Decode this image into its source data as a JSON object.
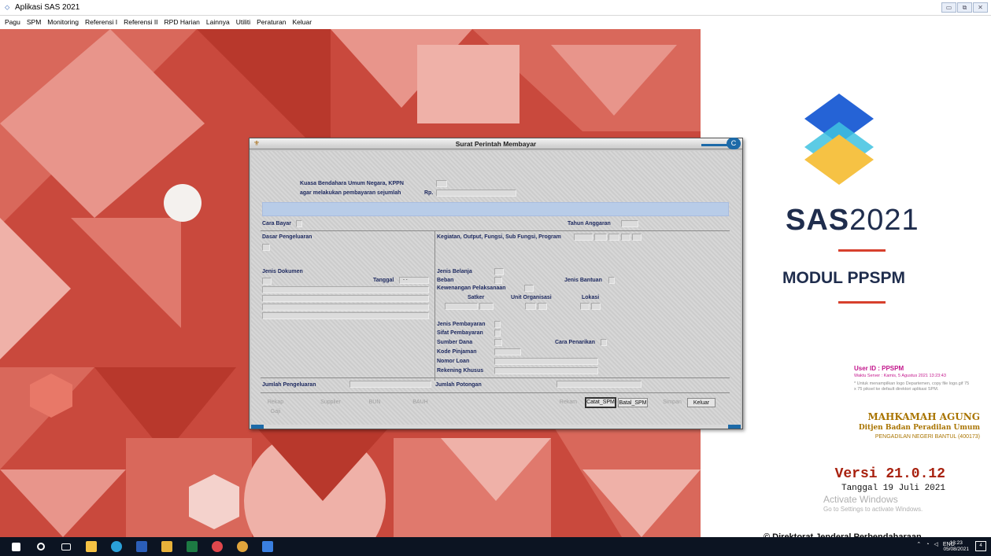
{
  "window": {
    "title": "Aplikasi SAS 2021",
    "icon": "app-icon",
    "controls": [
      "minimize-icon",
      "restore-icon",
      "close-icon"
    ]
  },
  "menu": [
    "Pagu",
    "SPM",
    "Monitoring",
    "Referensi I",
    "Referensi II",
    "RPD Harian",
    "Lainnya",
    "Utiliti",
    "Peraturan",
    "Keluar"
  ],
  "brand": {
    "sas": "SAS",
    "year": "2021",
    "modul": "MODUL PPSPM",
    "accent": "#d7402d",
    "navy": "#1f2d4d"
  },
  "user": {
    "id": "User ID : PPSPM",
    "server_time": "Waktu Server : Kamis, 5 Agustus 2021 13:23:43",
    "logo_note": "* Untuk menampilkan logo Departemen, copy file logo.gif 75 x 75 piksel ke default direktori aplikasi SPM."
  },
  "org": {
    "name": "MAHKAMAH AGUNG",
    "sub": "Ditjen Badan Peradilan Umum",
    "unit": "PENGADILAN NEGERI BANTUL (400173)"
  },
  "version": {
    "label": "Versi 21.0.12",
    "date": "Tanggal 19 Juli 2021"
  },
  "watermark": {
    "line1": "Activate Windows",
    "line2": "Go to Settings to activate Windows."
  },
  "copyright": "© Direktorat Jenderal Perbendaharaan",
  "taskbar": {
    "lang": "ENG",
    "time": "13:23",
    "date": "05/08/2021"
  },
  "dialog": {
    "title": "Surat Perintah Membayar",
    "kuasa_label": "Kuasa Bendahara Umum Negara, KPPN",
    "agar_label": "agar melakukan pembayaran sejumlah",
    "rp_label": "Rp.",
    "cara_bayar": "Cara Bayar",
    "tahun_anggaran": "Tahun Anggaran",
    "dasar_pengeluaran": "Dasar Pengeluaran",
    "kegiatan": "Kegiatan, Output, Fungsi, Sub Fungsi, Program",
    "jenis_dokumen": "Jenis Dokumen",
    "tanggal": "Tanggal",
    "tanggal_value": "- -",
    "jenis_belanja": "Jenis Belanja",
    "beban": "Beban",
    "jenis_bantuan": "Jenis Bantuan",
    "kewenangan": "Kewenangan Pelaksanaan",
    "satker": "Satker",
    "unit_organisasi": "Unit Organisasi",
    "lokasi": "Lokasi",
    "jenis_pembayaran": "Jenis Pembayaran",
    "sifat_pembayaran": "Sifat Pembayaran",
    "sumber_dana": "Sumber Dana",
    "cara_penarikan": "Cara Penarikan",
    "kode_pinjaman": "Kode Pinjaman",
    "nomor_loan": "Nomor Loan",
    "rekening_khusus": "Rekening Khusus",
    "jumlah_pengeluaran": "Jumlah Pengeluaran",
    "jumlah_potongan": "Jumlah Potongan",
    "buttons": {
      "rekap_gaji": "Rekap Gaji",
      "supplier": "Supplier",
      "bun": "BUN",
      "bauh": "BAUH",
      "rekam": "Rekam",
      "catat_spm": "Catat_SPM",
      "batal_spm": "Batal_SPM",
      "simpan": "Simpan",
      "keluar": "Keluar"
    }
  }
}
